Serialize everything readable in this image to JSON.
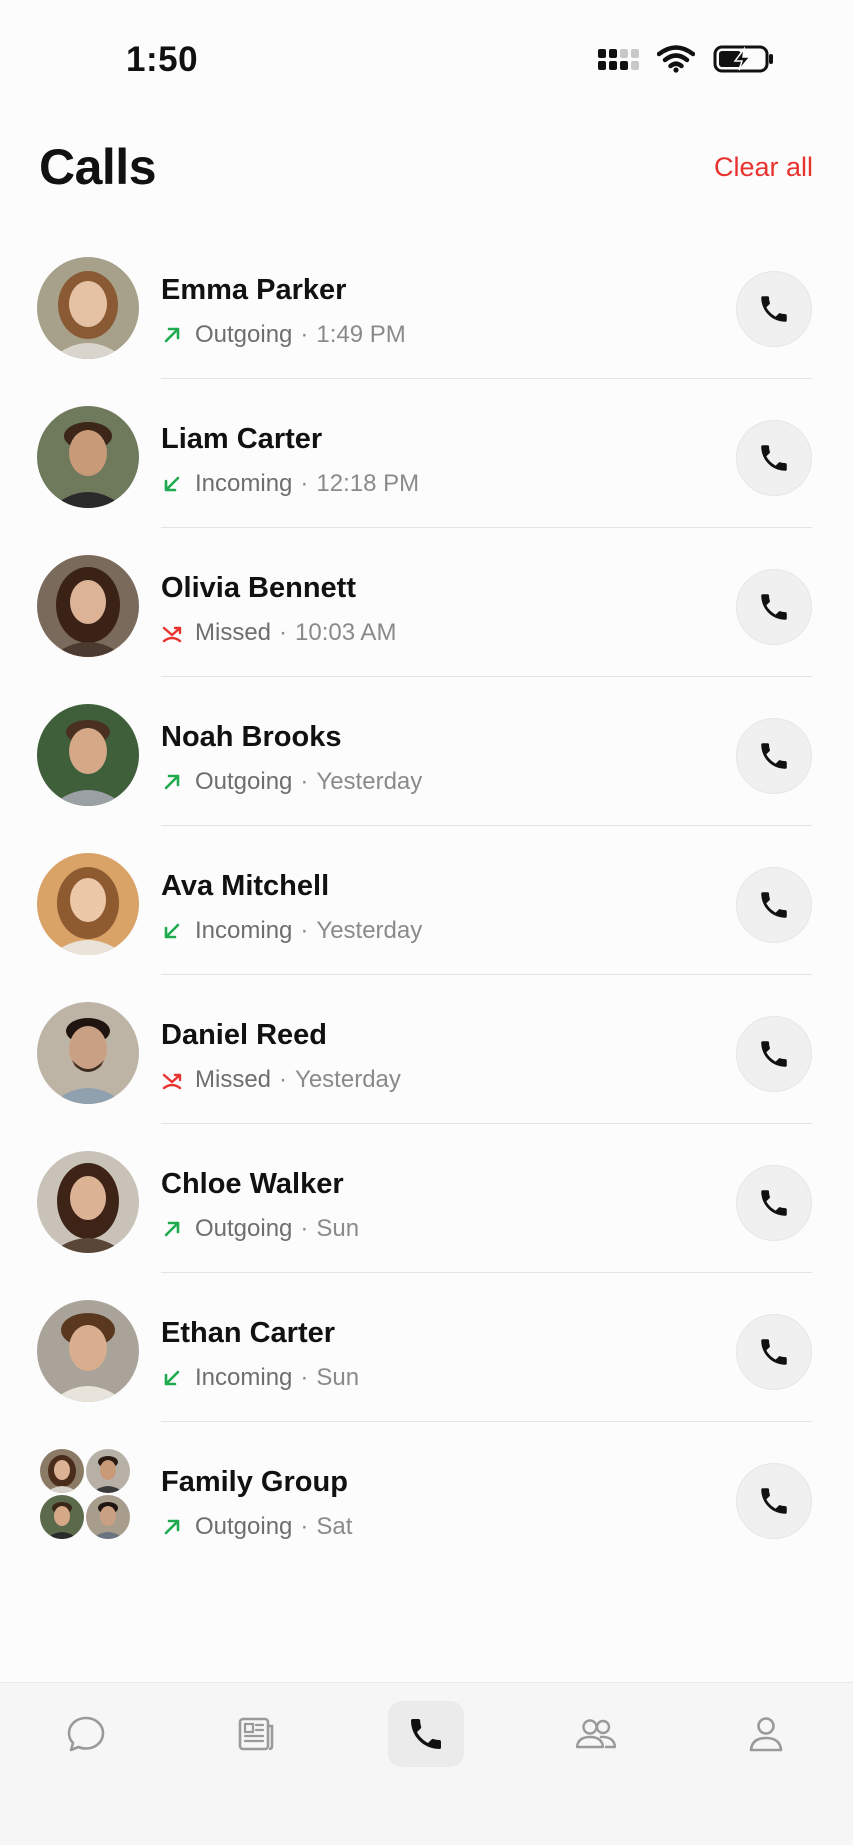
{
  "status_bar": {
    "time": "1:50"
  },
  "header": {
    "title": "Calls",
    "clear_all_label": "Clear all"
  },
  "colors": {
    "accent_red": "#e8322e",
    "outgoing_green": "#1faa4f",
    "incoming_green": "#1faa4f",
    "missed_red": "#e8322e"
  },
  "calls": [
    {
      "name": "Emma Parker",
      "direction": "outgoing",
      "type": "Outgoing",
      "time": "1:49 PM"
    },
    {
      "name": "Liam Carter",
      "direction": "incoming",
      "type": "Incoming",
      "time": "12:18 PM"
    },
    {
      "name": "Olivia Bennett",
      "direction": "missed",
      "type": "Missed",
      "time": "10:03 AM"
    },
    {
      "name": "Noah Brooks",
      "direction": "outgoing",
      "type": "Outgoing",
      "time": "Yesterday"
    },
    {
      "name": "Ava Mitchell",
      "direction": "incoming",
      "type": "Incoming",
      "time": "Yesterday"
    },
    {
      "name": "Daniel Reed",
      "direction": "missed",
      "type": "Missed",
      "time": "Yesterday"
    },
    {
      "name": "Chloe Walker",
      "direction": "outgoing",
      "type": "Outgoing",
      "time": "Sun"
    },
    {
      "name": "Ethan Carter",
      "direction": "incoming",
      "type": "Incoming",
      "time": "Sun"
    },
    {
      "name": "Family Group",
      "direction": "outgoing",
      "type": "Outgoing",
      "time": "Sat"
    }
  ],
  "tabs": [
    {
      "icon": "chat-bubble-icon",
      "active": false
    },
    {
      "icon": "newspaper-icon",
      "active": false
    },
    {
      "icon": "phone-icon",
      "active": true
    },
    {
      "icon": "people-icon",
      "active": false
    },
    {
      "icon": "person-icon",
      "active": false
    }
  ]
}
